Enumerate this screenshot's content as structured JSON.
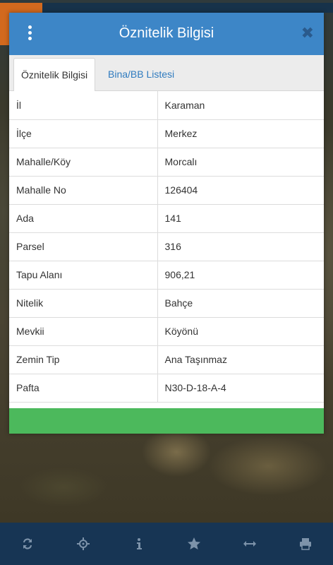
{
  "dialog": {
    "title": "Öznitelik Bilgisi",
    "close_icon": "✖",
    "tabs": [
      {
        "label": "Öznitelik Bilgisi",
        "active": true
      },
      {
        "label": "Bina/BB Listesi",
        "active": false
      }
    ],
    "rows": [
      {
        "key": "İl",
        "value": "Karaman"
      },
      {
        "key": "İlçe",
        "value": "Merkez"
      },
      {
        "key": "Mahalle/Köy",
        "value": "Morcalı"
      },
      {
        "key": "Mahalle No",
        "value": "126404"
      },
      {
        "key": "Ada",
        "value": "141"
      },
      {
        "key": "Parsel",
        "value": "316"
      },
      {
        "key": "Tapu Alanı",
        "value": "906,21"
      },
      {
        "key": "Nitelik",
        "value": "Bahçe"
      },
      {
        "key": "Mevkii",
        "value": "Köyönü"
      },
      {
        "key": "Zemin Tip",
        "value": "Ana Taşınmaz"
      },
      {
        "key": "Pafta",
        "value": "N30-D-18-A-4"
      }
    ]
  },
  "toolbar": {
    "items": [
      "refresh-icon",
      "locate-icon",
      "info-icon",
      "star-icon",
      "measure-icon",
      "print-icon"
    ]
  },
  "colors": {
    "header": "#3d86c7",
    "footer": "#4cb95c",
    "toolbar": "#173554",
    "tool_icon": "#7d93aa",
    "tab_link": "#2f7bbf"
  }
}
